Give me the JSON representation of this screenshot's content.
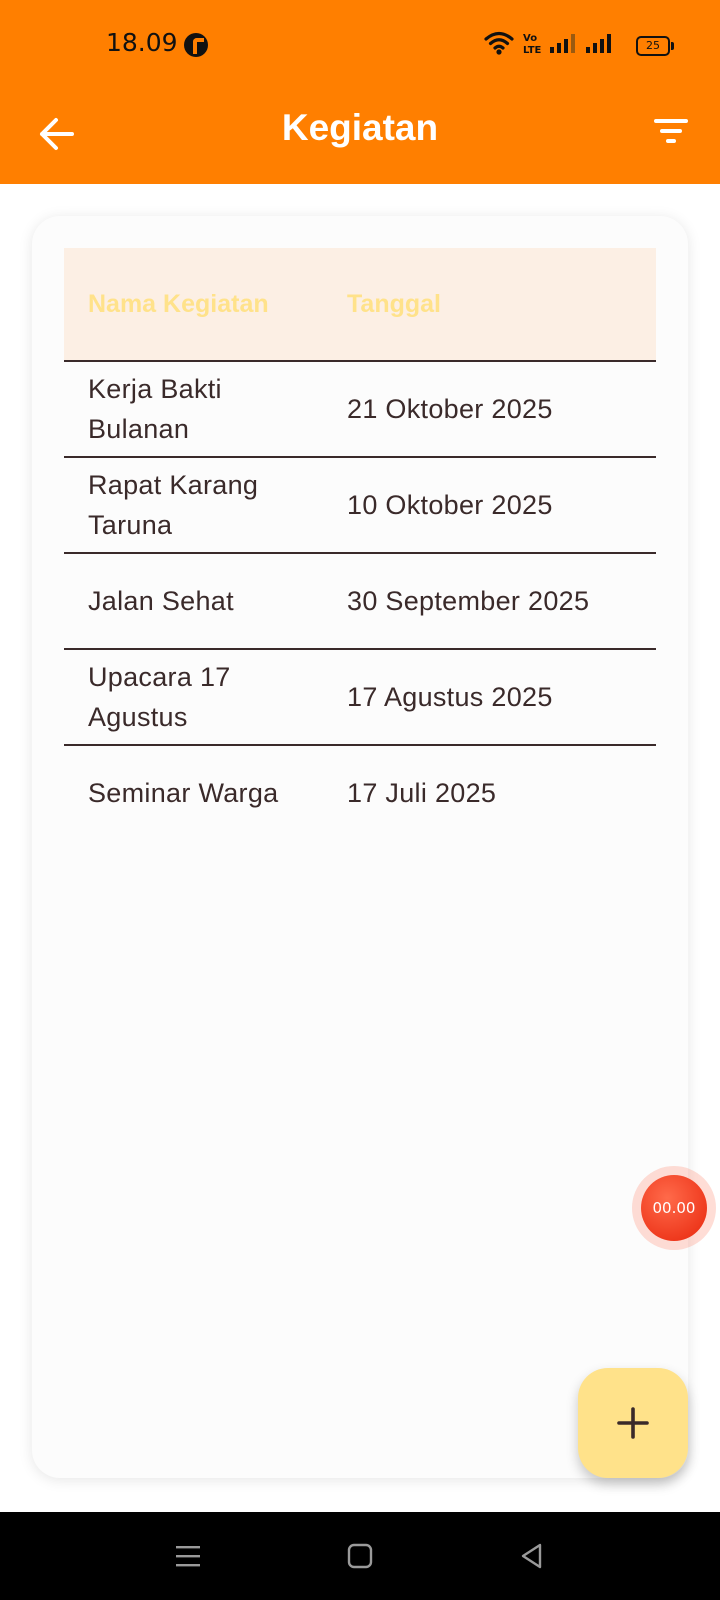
{
  "status_bar": {
    "time": "18.09",
    "battery": "25",
    "network_label": "Vo LTE"
  },
  "app_bar": {
    "title": "Kegiatan",
    "back_icon": "arrow-left-icon",
    "filter_icon": "filter-icon"
  },
  "table": {
    "headers": [
      "Nama Kegiatan",
      "Tanggal"
    ],
    "rows": [
      {
        "name": "Kerja Bakti Bulanan",
        "date": "21 Oktober 2025"
      },
      {
        "name": "Rapat Karang Taruna",
        "date": "10 Oktober 2025"
      },
      {
        "name": "Jalan Sehat",
        "date": "30 September 2025"
      },
      {
        "name": "Upacara 17 Agustus",
        "date": "17 Agustus 2025"
      },
      {
        "name": "Seminar Warga",
        "date": "17 Juli 2025"
      }
    ]
  },
  "timer": {
    "value": "00.00"
  },
  "fab": {
    "icon": "plus-icon"
  },
  "colors": {
    "primary": "#FF7F00",
    "header_bg": "#FCEFE4",
    "header_text": "#FFE28A",
    "fab_bg": "#FFE28A",
    "row_text": "#3a2a2a"
  }
}
